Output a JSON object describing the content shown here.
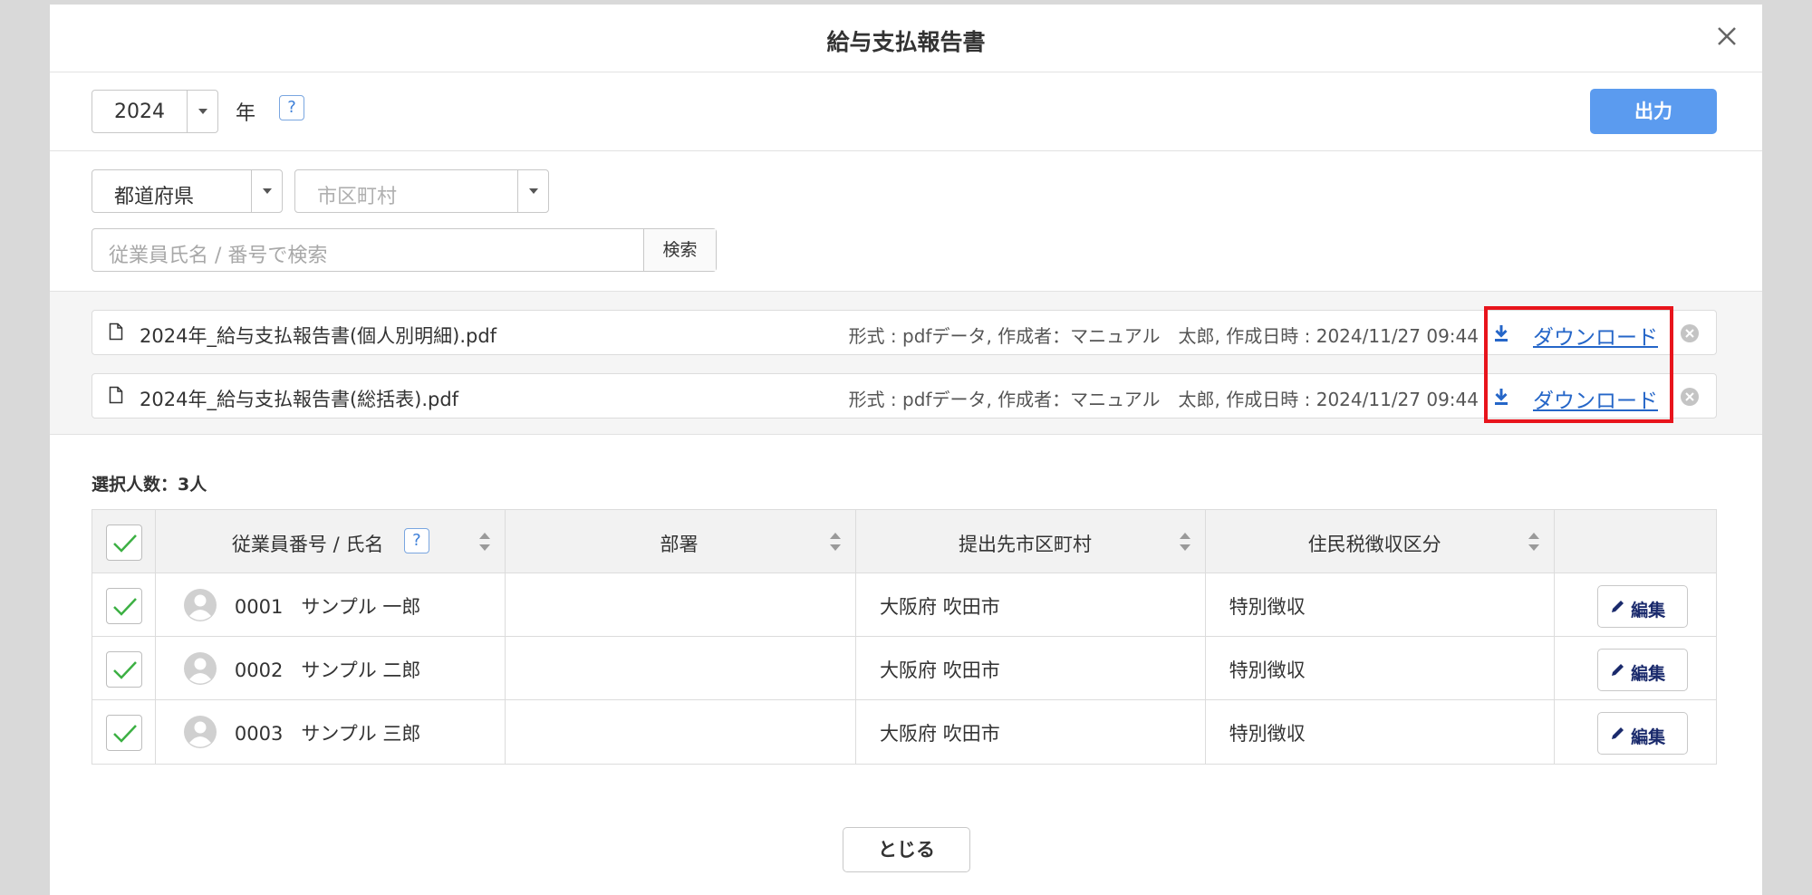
{
  "dialog": {
    "title": "給与支払報告書"
  },
  "year_row": {
    "year_value": "2024",
    "year_label": "年",
    "help": "?",
    "output_label": "出力"
  },
  "filters": {
    "prefecture_value": "都道府県",
    "city_placeholder": "市区町村",
    "search_placeholder": "従業員氏名 / 番号で検索",
    "search_button": "検索"
  },
  "files": [
    {
      "name": "2024年_給与支払報告書(個人別明細).pdf",
      "meta": "形式 : pdfデータ, 作成者：マニュアル　太郎, 作成日時 : 2024/11/27 09:44",
      "download": "ダウンロード"
    },
    {
      "name": "2024年_給与支払報告書(総括表).pdf",
      "meta": "形式 : pdfデータ, 作成者：マニュアル　太郎, 作成日時 : 2024/11/27 09:44",
      "download": "ダウンロード"
    }
  ],
  "selection": {
    "count_text": "選択人数：3人"
  },
  "table": {
    "headers": {
      "employee": "従業員番号 / 氏名",
      "dept": "部署",
      "city": "提出先市区町村",
      "tax": "住民税徴収区分"
    },
    "rows": [
      {
        "employee": "0001   サンプル 一郎",
        "dept": "",
        "city": "大阪府 吹田市",
        "tax": "特別徴収",
        "edit": "編集"
      },
      {
        "employee": "0002   サンプル 二郎",
        "dept": "",
        "city": "大阪府 吹田市",
        "tax": "特別徴収",
        "edit": "編集"
      },
      {
        "employee": "0003   サンプル 三郎",
        "dept": "",
        "city": "大阪府 吹田市",
        "tax": "特別徴収",
        "edit": "編集"
      }
    ]
  },
  "footer": {
    "close_label": "とじる"
  },
  "colors": {
    "accent": "#5b9bef",
    "link": "#2566c8",
    "highlight": "#e8141c",
    "check": "#3cb043"
  }
}
